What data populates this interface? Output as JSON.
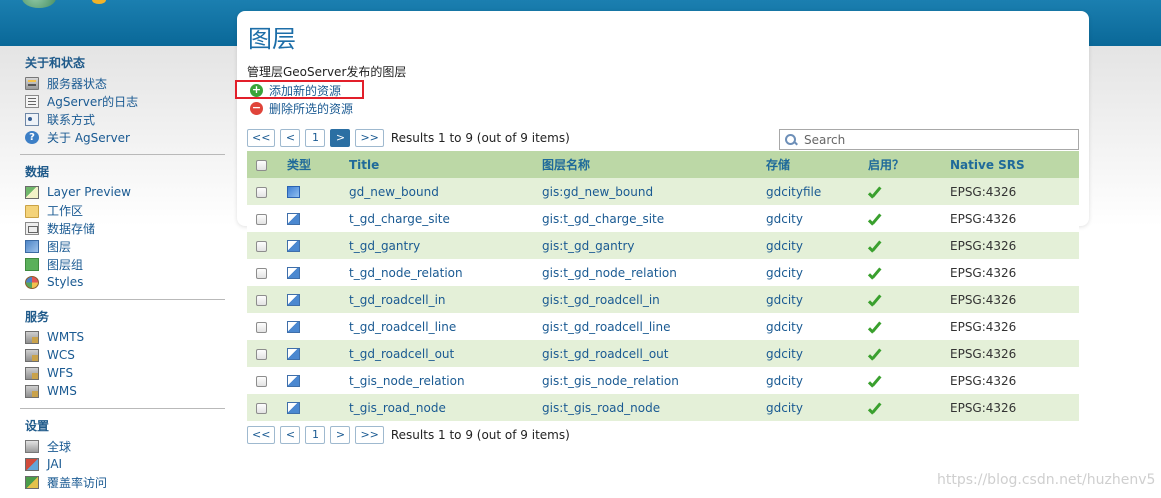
{
  "sidebar": {
    "sections": [
      {
        "title": "关于和状态",
        "items": [
          {
            "label": "服务器状态",
            "icon": "server-status-icon"
          },
          {
            "label": "AgServer的日志",
            "icon": "log-icon"
          },
          {
            "label": "联系方式",
            "icon": "contact-icon"
          },
          {
            "label": "关于 AgServer",
            "icon": "help-icon"
          }
        ]
      },
      {
        "title": "数据",
        "items": [
          {
            "label": "Layer Preview",
            "icon": "layer-preview-icon"
          },
          {
            "label": "工作区",
            "icon": "folder-icon"
          },
          {
            "label": "数据存储",
            "icon": "store-icon"
          },
          {
            "label": "图层",
            "icon": "layer-icon"
          },
          {
            "label": "图层组",
            "icon": "layer-group-icon"
          },
          {
            "label": "Styles",
            "icon": "styles-icon"
          }
        ]
      },
      {
        "title": "服务",
        "items": [
          {
            "label": "WMTS",
            "icon": "service-icon"
          },
          {
            "label": "WCS",
            "icon": "service-icon"
          },
          {
            "label": "WFS",
            "icon": "service-icon"
          },
          {
            "label": "WMS",
            "icon": "service-icon"
          }
        ]
      },
      {
        "title": "设置",
        "items": [
          {
            "label": "全球",
            "icon": "global-settings-icon"
          },
          {
            "label": "JAI",
            "icon": "jai-icon"
          },
          {
            "label": "覆盖率访问",
            "icon": "coverage-access-icon"
          }
        ]
      }
    ]
  },
  "main": {
    "title": "图层",
    "description": "管理层GeoServer发布的图层",
    "add_label": "添加新的资源",
    "remove_label": "删除所选的资源",
    "pager": {
      "first": "<<",
      "prev": "<",
      "page1": "1",
      "next": ">",
      "last": ">>",
      "results": "Results 1 to 9 (out of 9 items)"
    },
    "search": {
      "placeholder": "Search"
    },
    "columns": {
      "type": "类型",
      "title": "Title",
      "name": "图层名称",
      "store": "存储",
      "enabled": "启用？",
      "srs": "Native SRS"
    },
    "rows": [
      {
        "type": "raster",
        "title": "gd_new_bound",
        "name": "gis:gd_new_bound",
        "store": "gdcityfile",
        "enabled": true,
        "srs": "EPSG:4326"
      },
      {
        "type": "vector",
        "title": "t_gd_charge_site",
        "name": "gis:t_gd_charge_site",
        "store": "gdcity",
        "enabled": true,
        "srs": "EPSG:4326"
      },
      {
        "type": "vector",
        "title": "t_gd_gantry",
        "name": "gis:t_gd_gantry",
        "store": "gdcity",
        "enabled": true,
        "srs": "EPSG:4326"
      },
      {
        "type": "vector",
        "title": "t_gd_node_relation",
        "name": "gis:t_gd_node_relation",
        "store": "gdcity",
        "enabled": true,
        "srs": "EPSG:4326"
      },
      {
        "type": "vector",
        "title": "t_gd_roadcell_in",
        "name": "gis:t_gd_roadcell_in",
        "store": "gdcity",
        "enabled": true,
        "srs": "EPSG:4326"
      },
      {
        "type": "vector",
        "title": "t_gd_roadcell_line",
        "name": "gis:t_gd_roadcell_line",
        "store": "gdcity",
        "enabled": true,
        "srs": "EPSG:4326"
      },
      {
        "type": "vector",
        "title": "t_gd_roadcell_out",
        "name": "gis:t_gd_roadcell_out",
        "store": "gdcity",
        "enabled": true,
        "srs": "EPSG:4326"
      },
      {
        "type": "vector",
        "title": "t_gis_node_relation",
        "name": "gis:t_gis_node_relation",
        "store": "gdcity",
        "enabled": true,
        "srs": "EPSG:4326"
      },
      {
        "type": "vector",
        "title": "t_gis_road_node",
        "name": "gis:t_gis_road_node",
        "store": "gdcity",
        "enabled": true,
        "srs": "EPSG:4326"
      }
    ]
  },
  "watermark": "https://blog.csdn.net/huzhenv5",
  "colors": {
    "header": "#0a6898",
    "table_header": "#bcd8a6",
    "row_alt": "#e4f0d8",
    "link": "#1a5a92",
    "highlight": "#e21f2a"
  }
}
